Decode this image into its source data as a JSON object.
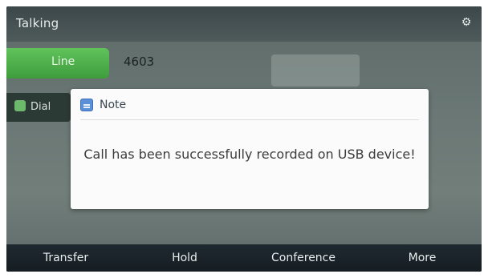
{
  "status_bar": {
    "title": "Talking",
    "right_icon": "settings-icon"
  },
  "call": {
    "line_label": "Line",
    "number": "4603"
  },
  "secondary": {
    "label": "Dial"
  },
  "dialog": {
    "icon": "note-icon",
    "title": "Note",
    "message": "Call has been successfully recorded on USB device!"
  },
  "softkeys": [
    {
      "label": "Transfer"
    },
    {
      "label": "Hold"
    },
    {
      "label": "Conference"
    },
    {
      "label": "More"
    }
  ],
  "colors": {
    "line_key": "#4caf4a",
    "dialog_bg": "#fbfbfb",
    "softkey_bar": "#182126"
  }
}
